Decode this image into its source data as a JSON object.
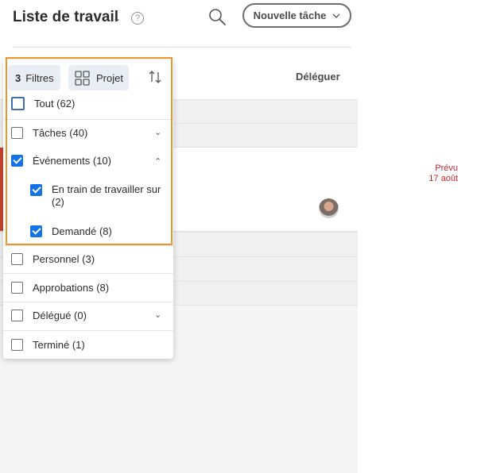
{
  "header": {
    "title": "Liste de travail",
    "new_task_label": "Nouvelle tâche"
  },
  "columns": {
    "delegate_label": "Déléguer"
  },
  "task": {
    "due_line1": "Prévu",
    "due_line2": "17 août"
  },
  "toolbar": {
    "filters_count": "3",
    "filters_label": "Filtres",
    "project_label": "Projet"
  },
  "filters": {
    "all": "Tout (62)",
    "tasks": "Tâches (40)",
    "events": "Événements (10)",
    "working_on": "En train de travailler sur (2)",
    "requested": "Demandé (8)",
    "personal": "Personnel (3)",
    "approvals": "Approbations (8)",
    "delegated": "Délégué (0)",
    "done": "Terminé (1)"
  },
  "colors": {
    "accent": "#1473e6",
    "highlight": "#e8962e",
    "due": "#c9252d"
  }
}
